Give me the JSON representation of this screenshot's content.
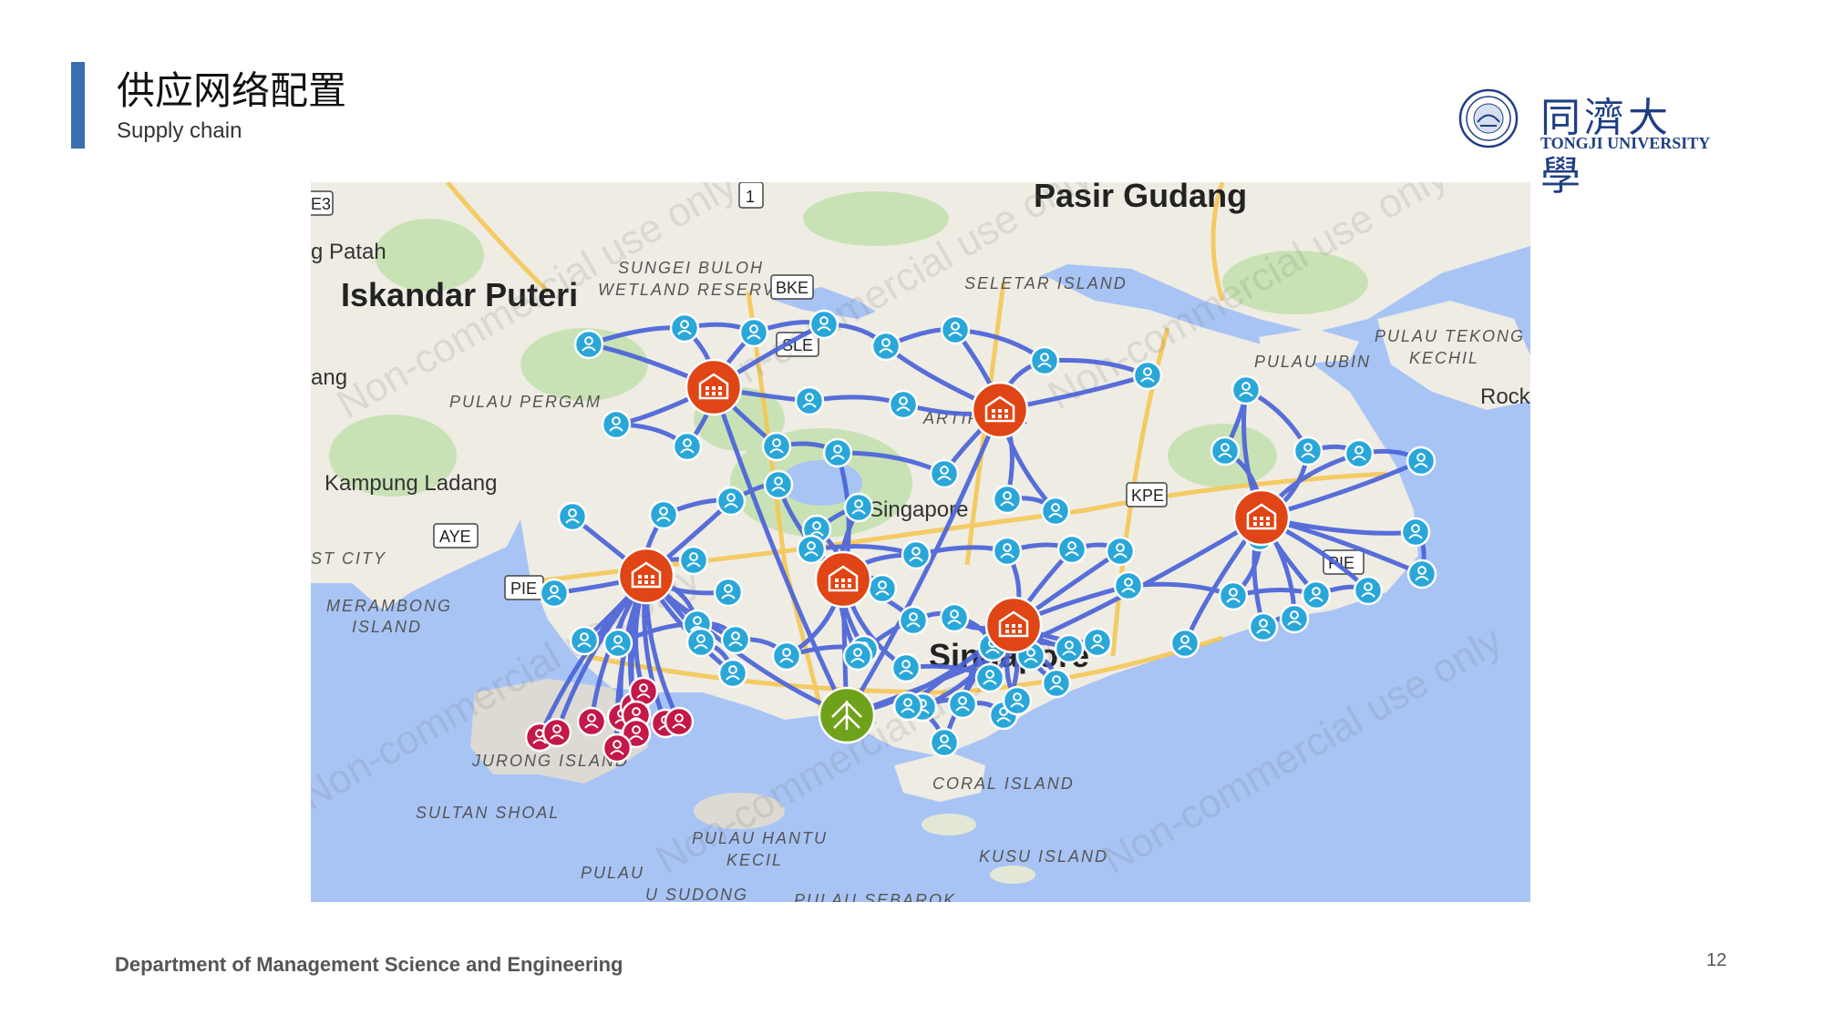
{
  "header": {
    "title": "供应网络配置",
    "subtitle": "Supply chain"
  },
  "logo": {
    "name_cn": "同濟大學",
    "name_en": "TONGJI UNIVERSITY"
  },
  "map": {
    "places": {
      "pasir_gudang": "Pasir Gudang",
      "iskandar_puteri": "Iskandar Puteri",
      "g_patah": "g Patah",
      "kampung_ladang": "Kampung Ladang",
      "singapore_center": "Singapore",
      "singapore_south": "Singapore",
      "rocky": "Rocky",
      "ang": "ang",
      "st_city": "ST CITY"
    },
    "islands": {
      "sungei_buloh": "SUNGEI BULOH",
      "wetland_reserve": "WETLAND RESERVE",
      "seletar": "SELETAR ISLAND",
      "pulau_tekong": "PULAU TEKONG",
      "kechil": "KECHIL",
      "pulau_ubin": "PULAU UBIN",
      "pulau_pergam": "PULAU PERGAM",
      "artificial": "ARTIFICIAL",
      "merambong": "MERAMBONG",
      "island": "ISLAND",
      "jurong_island": "JURONG ISLAND",
      "sultan_shoal": "SULTAN SHOAL",
      "pulau_hantu": "PULAU HANTU",
      "kecil": "KECIL",
      "pulau": "PULAU",
      "u_sudong": "U SUDONG",
      "coral_island": "CORAL ISLAND",
      "kusu_island": "KUSU ISLAND",
      "pulau_sebarok": "PULAU SEBAROK"
    },
    "shields": [
      "E3",
      "1",
      "BKE",
      "SLE",
      "AYE",
      "PIE",
      "KPE",
      "PIE"
    ],
    "watermark": "Non-commercial use only",
    "colors": {
      "water": "#a8c4f5",
      "land": "#efece4",
      "route": "#4a63d8",
      "customer": "#2aa7d9",
      "warehouse": "#e04515",
      "supplier": "#6ea21a",
      "jurong_customer": "#c31848"
    },
    "icons": {
      "customer": "person-pin-icon",
      "warehouse": "warehouse-icon",
      "supplier": "supplier-hub-icon",
      "jurong_customer": "person-pin-icon"
    },
    "warehouse_count": 6,
    "customer_count": 72,
    "supplier_count": 1,
    "jurong_customer_count": 11
  },
  "footer": {
    "department": "Department of Management Science and Engineering",
    "page_number": "12"
  }
}
